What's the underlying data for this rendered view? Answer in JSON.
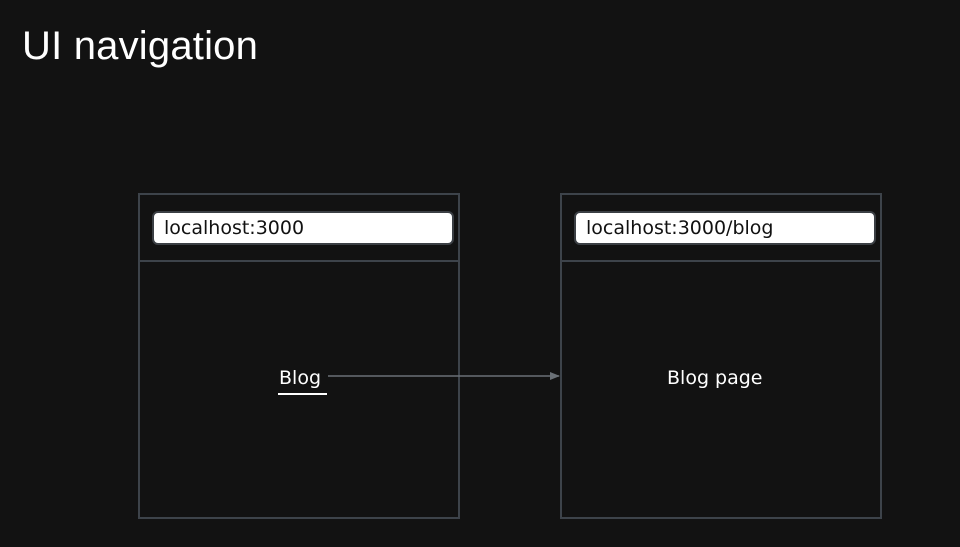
{
  "title": "UI navigation",
  "left_browser": {
    "address": "localhost:3000",
    "link_label": "Blog"
  },
  "right_browser": {
    "address": "localhost:3000/blog",
    "page_label": "Blog page"
  },
  "colors": {
    "background": "#121212",
    "frame_border": "#3d434a",
    "arrow": "#6a7076",
    "text": "#ffffff"
  }
}
